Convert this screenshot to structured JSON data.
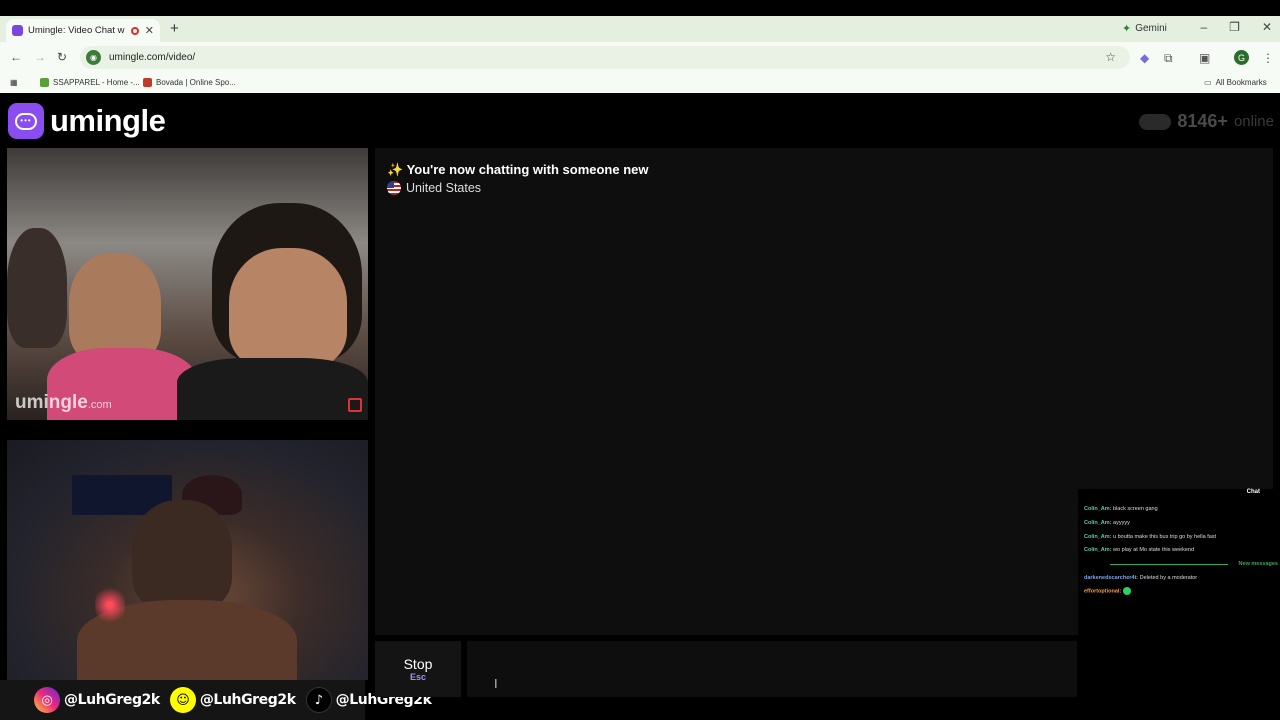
{
  "browser": {
    "tab_title": "Umingle: Video Chat with S",
    "new_tab": "+",
    "gemini_label": "Gemini",
    "url": "umingle.com/video/",
    "bookmarks": [
      "SSAPPAREL - Home -...",
      "Bovada | Online Spo..."
    ],
    "all_bookmarks": "All Bookmarks",
    "profile_initial": "G"
  },
  "brand": {
    "name": "umingle",
    "accent_color": "#8a4df0"
  },
  "online": {
    "count": "8146+",
    "label": "online"
  },
  "chat": {
    "notice": "✨ You're now chatting with someone new",
    "country": "United States"
  },
  "videos": {
    "watermark_main": "umingle",
    "watermark_suffix": ".com"
  },
  "controls": {
    "stop_label": "Stop",
    "stop_key": "Esc",
    "message_placeholder": ""
  },
  "socials": [
    {
      "icon": "instagram-icon",
      "handle": "@LuhGreg2k"
    },
    {
      "icon": "snapchat-icon",
      "handle": "@LuhGreg2k"
    },
    {
      "icon": "tiktok-icon",
      "handle": "@LuhGreg2k"
    }
  ],
  "stream_chat": {
    "title": "Chat",
    "messages": [
      {
        "user": "Colin_Am:",
        "text": "black screen gang"
      },
      {
        "user": "Colin_Am:",
        "text": "ayyyyy"
      },
      {
        "user": "Colin_Am:",
        "text": "u boutta make this bus trip go by hella fast"
      },
      {
        "user": "Colin_Am:",
        "text": "wo play at Mo state this weekend"
      }
    ],
    "new_messages": "New messages",
    "after": [
      {
        "user": "darkenedscarcher4t:",
        "text": "Deleted by a moderator"
      },
      {
        "user": "effortoptional:",
        "text": ""
      }
    ]
  }
}
